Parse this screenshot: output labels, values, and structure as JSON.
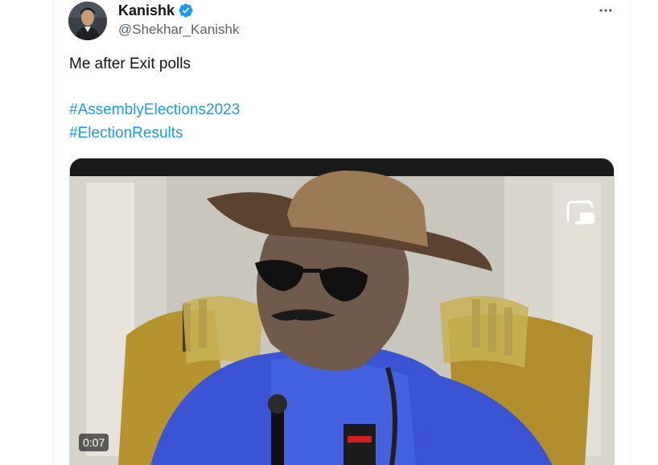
{
  "tweet": {
    "author": {
      "display_name": "Kanishk",
      "handle": "@Shekhar_Kanishk",
      "verified": true,
      "avatar_icon": "profile-photo"
    },
    "text": "Me after Exit polls",
    "hashtags": [
      "#AssemblyElections2023",
      "#ElectionResults"
    ],
    "media": {
      "type": "video",
      "duration": "0:07",
      "pip_icon": "picture-in-picture-icon"
    },
    "more_icon": "more-options-icon"
  },
  "colors": {
    "text_primary": "#0f1419",
    "text_secondary": "#536471",
    "link": "#1d9bf0",
    "verified": "#1d9bf0"
  }
}
